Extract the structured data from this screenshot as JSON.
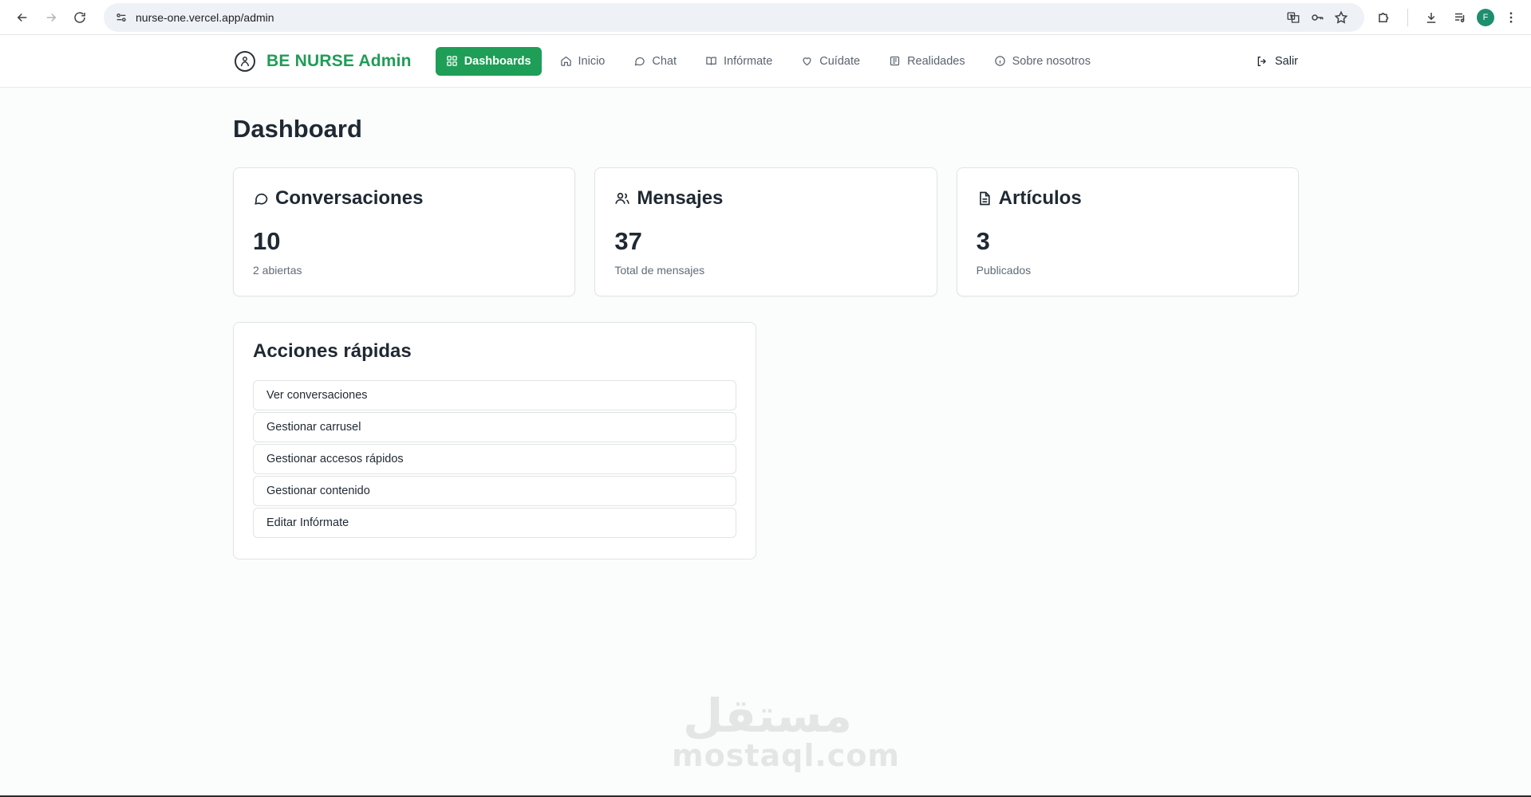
{
  "browser": {
    "url": "nurse-one.vercel.app/admin",
    "profile_initial": "F"
  },
  "header": {
    "brand": "BE NURSE Admin",
    "nav": [
      {
        "label": "Dashboards",
        "icon": "grid-icon",
        "active": true
      },
      {
        "label": "Inicio",
        "icon": "home-icon"
      },
      {
        "label": "Chat",
        "icon": "chat-icon"
      },
      {
        "label": "Infórmate",
        "icon": "book-icon"
      },
      {
        "label": "Cuídate",
        "icon": "heart-icon"
      },
      {
        "label": "Realidades",
        "icon": "newspaper-icon"
      },
      {
        "label": "Sobre nosotros",
        "icon": "info-icon"
      }
    ],
    "logout": "Salir"
  },
  "main": {
    "title": "Dashboard",
    "stats": [
      {
        "title": "Conversaciones",
        "value": "10",
        "sub": "2 abiertas",
        "icon": "chat-icon"
      },
      {
        "title": "Mensajes",
        "value": "37",
        "sub": "Total de mensajes",
        "icon": "users-icon"
      },
      {
        "title": "Artículos",
        "value": "3",
        "sub": "Publicados",
        "icon": "document-icon"
      }
    ],
    "quick_actions": {
      "title": "Acciones rápidas",
      "items": [
        "Ver conversaciones",
        "Gestionar carrusel",
        "Gestionar accesos rápidos",
        "Gestionar contenido",
        "Editar Infórmate"
      ]
    }
  },
  "watermark": {
    "arabic": "مستقل",
    "latin": "mostaql.com"
  },
  "colors": {
    "accent": "#1e9e56",
    "brand": "#1f9d57"
  }
}
